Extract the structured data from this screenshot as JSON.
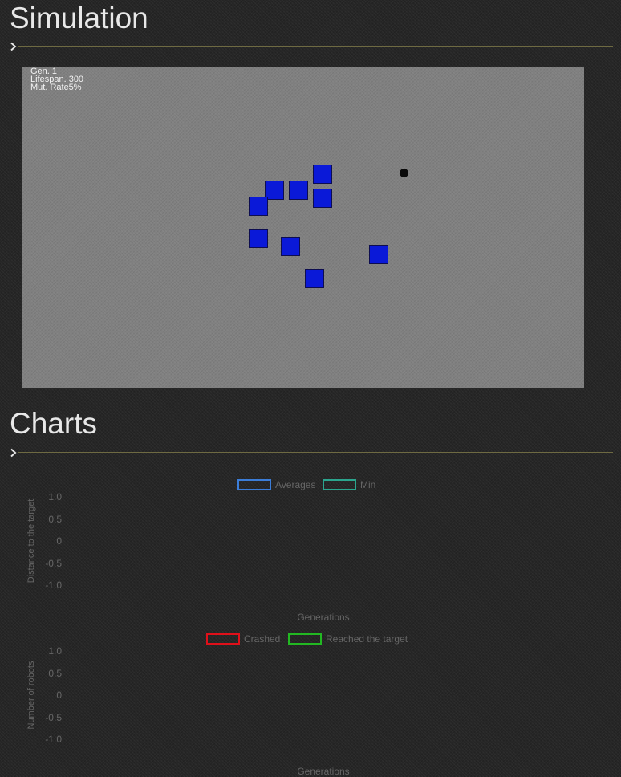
{
  "simulation": {
    "title": "Simulation",
    "hud": {
      "generation": "Gen. 1",
      "lifespan": "Lifespan. 300",
      "mutation_rate": "Mut. Rate5%"
    },
    "robot_color": "#0a19d8",
    "robot_count": 10,
    "target_color": "#0a0a0a",
    "canvas_color": "#808080"
  },
  "charts": {
    "title": "Charts",
    "distance_chart": {
      "legend": [
        {
          "label": "Averages",
          "color": "#3b7dd8"
        },
        {
          "label": "Min",
          "color": "#2ba58e"
        }
      ],
      "ylabel": "Distance to the target",
      "xlabel": "Generations",
      "yticks": [
        "1.0",
        "0.5",
        "0",
        "-0.5",
        "-1.0"
      ]
    },
    "robots_chart": {
      "legend": [
        {
          "label": "Crashed",
          "color": "#e0101a"
        },
        {
          "label": "Reached the target",
          "color": "#22b822"
        }
      ],
      "ylabel": "Number of robots",
      "xlabel": "Generations",
      "yticks": [
        "1.0",
        "0.5",
        "0",
        "-0.5",
        "-1.0"
      ]
    }
  },
  "chart_data": [
    {
      "type": "line",
      "x": [],
      "series": [
        {
          "name": "Averages",
          "values": []
        },
        {
          "name": "Min",
          "values": []
        }
      ],
      "xlabel": "Generations",
      "ylabel": "Distance to the target",
      "ylim": [
        -1.0,
        1.0
      ],
      "legend_position": "top-center"
    },
    {
      "type": "line",
      "x": [],
      "series": [
        {
          "name": "Crashed",
          "values": []
        },
        {
          "name": "Reached the target",
          "values": []
        }
      ],
      "xlabel": "Generations",
      "ylabel": "Number of robots",
      "ylim": [
        -1.0,
        1.0
      ],
      "legend_position": "top-center"
    }
  ]
}
